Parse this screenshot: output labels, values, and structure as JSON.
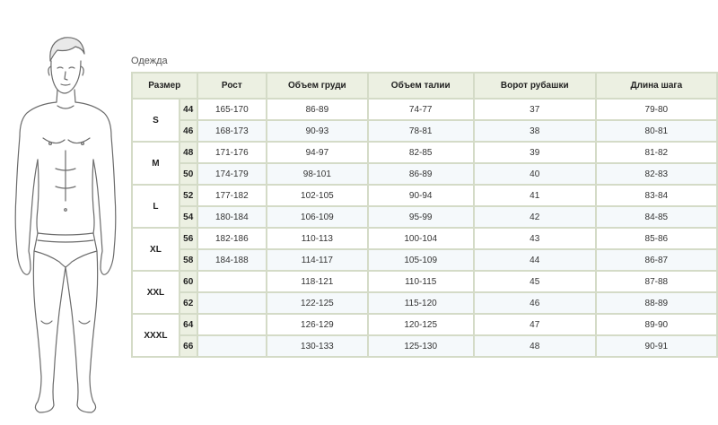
{
  "caption": "Одежда",
  "headers": {
    "size": "Размер",
    "height": "Рост",
    "chest": "Объем груди",
    "waist": "Объем талии",
    "collar": "Ворот рубашки",
    "inseam": "Длина шага"
  },
  "groups": [
    {
      "label": "S",
      "rows": [
        {
          "ru": "44",
          "height": "165-170",
          "chest": "86-89",
          "waist": "74-77",
          "collar": "37",
          "inseam": "79-80"
        },
        {
          "ru": "46",
          "height": "168-173",
          "chest": "90-93",
          "waist": "78-81",
          "collar": "38",
          "inseam": "80-81"
        }
      ]
    },
    {
      "label": "M",
      "rows": [
        {
          "ru": "48",
          "height": "171-176",
          "chest": "94-97",
          "waist": "82-85",
          "collar": "39",
          "inseam": "81-82"
        },
        {
          "ru": "50",
          "height": "174-179",
          "chest": "98-101",
          "waist": "86-89",
          "collar": "40",
          "inseam": "82-83"
        }
      ]
    },
    {
      "label": "L",
      "rows": [
        {
          "ru": "52",
          "height": "177-182",
          "chest": "102-105",
          "waist": "90-94",
          "collar": "41",
          "inseam": "83-84"
        },
        {
          "ru": "54",
          "height": "180-184",
          "chest": "106-109",
          "waist": "95-99",
          "collar": "42",
          "inseam": "84-85"
        }
      ]
    },
    {
      "label": "XL",
      "rows": [
        {
          "ru": "56",
          "height": "182-186",
          "chest": "110-113",
          "waist": "100-104",
          "collar": "43",
          "inseam": "85-86"
        },
        {
          "ru": "58",
          "height": "184-188",
          "chest": "114-117",
          "waist": "105-109",
          "collar": "44",
          "inseam": "86-87"
        }
      ]
    },
    {
      "label": "XXL",
      "rows": [
        {
          "ru": "60",
          "height": "",
          "chest": "118-121",
          "waist": "110-115",
          "collar": "45",
          "inseam": "87-88"
        },
        {
          "ru": "62",
          "height": "",
          "chest": "122-125",
          "waist": "115-120",
          "collar": "46",
          "inseam": "88-89"
        }
      ]
    },
    {
      "label": "XXXL",
      "rows": [
        {
          "ru": "64",
          "height": "",
          "chest": "126-129",
          "waist": "120-125",
          "collar": "47",
          "inseam": "89-90"
        },
        {
          "ru": "66",
          "height": "",
          "chest": "130-133",
          "waist": "125-130",
          "collar": "48",
          "inseam": "90-91"
        }
      ]
    }
  ],
  "icons": {
    "figure": "male-body-outline-figure"
  },
  "colors": {
    "border": "#d4dbc7",
    "header_bg": "#ecf0e2",
    "alt_row_bg": "#f5f9fb"
  }
}
